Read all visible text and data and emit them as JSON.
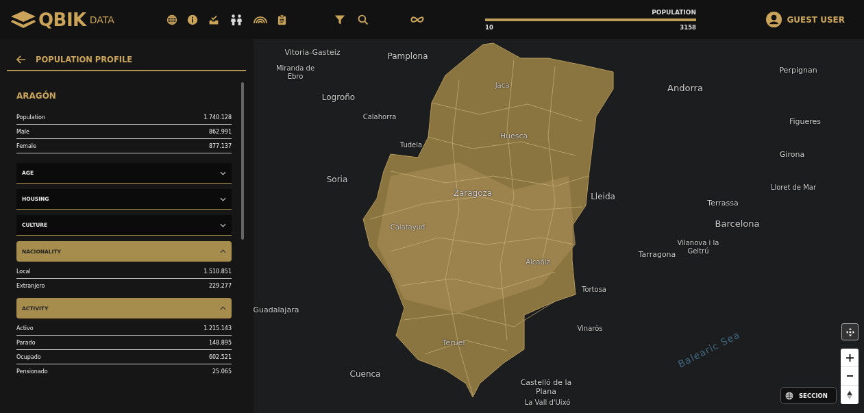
{
  "header": {
    "brand": "QBIK",
    "brand_suffix": "DATA",
    "population_filter": {
      "label": "POPULATION",
      "min": "10",
      "max": "3158",
      "level": 1
    },
    "user": {
      "name": "GUEST USER"
    }
  },
  "panel": {
    "title": "POPULATION PROFILE",
    "region": "ARAGÓN",
    "stats": [
      {
        "label": "Population",
        "value": "1.740.128"
      },
      {
        "label": "Male",
        "value": "862.991"
      },
      {
        "label": "Female",
        "value": "877.137"
      }
    ],
    "sections": [
      {
        "title": "AGE",
        "expanded": false
      },
      {
        "title": "HOUSING",
        "expanded": false
      },
      {
        "title": "CULTURE",
        "expanded": false
      },
      {
        "title": "NACIONALITY",
        "expanded": true,
        "rows": [
          {
            "label": "Local",
            "value": "1.510.851"
          },
          {
            "label": "Extranjero",
            "value": "229.277"
          }
        ]
      },
      {
        "title": "ACTIVITY",
        "expanded": true,
        "rows": [
          {
            "label": "Activo",
            "value": "1.215.143"
          },
          {
            "label": "Parado",
            "value": "148.895"
          },
          {
            "label": "Ocupado",
            "value": "602.521"
          },
          {
            "label": "Pensionado",
            "value": "25.065"
          }
        ]
      }
    ]
  },
  "map": {
    "labels": [
      "Vitoria-Gasteiz",
      "Pamplona",
      "Miranda de Ebro",
      "Logroño",
      "Calahorra",
      "Tudela",
      "Jaca",
      "Huesca",
      "Soria",
      "Zaragoza",
      "Calatayud",
      "Alcañiz",
      "Lleida",
      "Andorra",
      "Perpignan",
      "Figueres",
      "Girona",
      "Lloret de Mar",
      "Terrassa",
      "Barcelona",
      "Vilanova i la Geltrú",
      "Tarragona",
      "Tortosa",
      "Vinaròs",
      "Guadalajara",
      "Teruel",
      "Cuenca",
      "Castelló de la Plana",
      "La Vall d'Uixó"
    ],
    "sea_label": "Balearic Sea",
    "layer_button": "SECCION"
  }
}
